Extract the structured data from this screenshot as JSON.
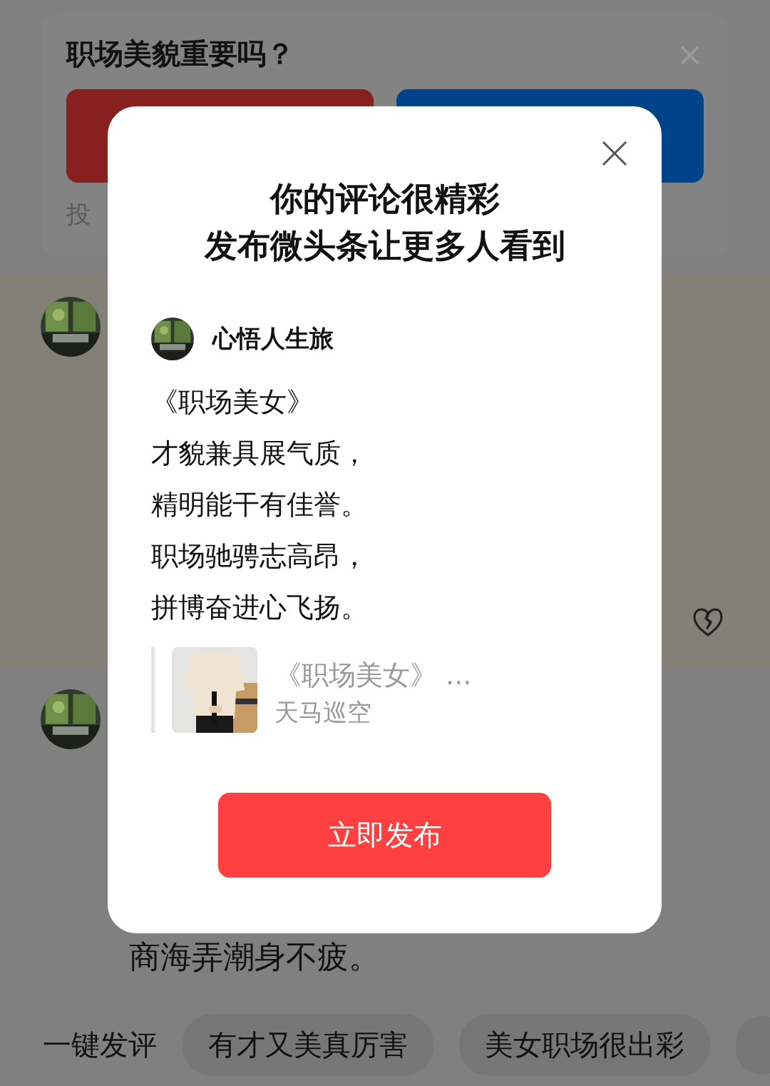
{
  "poll": {
    "question": "职场美貌重要吗？",
    "close_icon": "×",
    "options": [
      {
        "color": "#892020"
      },
      {
        "color": "#00438a"
      }
    ],
    "footer": "投"
  },
  "comments": [
    {
      "highlighted": true,
      "liked": false
    },
    {
      "highlighted": false,
      "text": "商海弄潮身不疲。"
    }
  ],
  "quick_reply": {
    "label": "一键发评",
    "chips": [
      {
        "kind": "text",
        "label": "有才又美真厉害"
      },
      {
        "kind": "text",
        "label": "美女职场很出彩"
      },
      {
        "kind": "partial"
      }
    ]
  },
  "dialog": {
    "title_lines": [
      "你的评论很精彩",
      "发布微头条让更多人看到"
    ],
    "author": {
      "name": "心悟人生旅"
    },
    "poem": [
      "《职场美女》",
      "才貌兼具展气质，",
      "精明能干有佳誉。",
      "职场驰骋志高昂，",
      "拼博奋进心飞扬。"
    ],
    "quote": {
      "title": "《职场美女》 ...",
      "author": "天马巡空"
    },
    "button": "立即发布"
  }
}
